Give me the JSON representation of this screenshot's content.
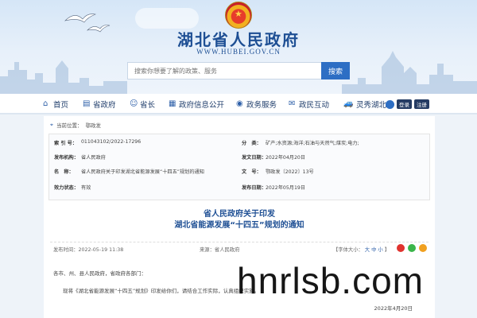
{
  "header": {
    "title": "湖北省人民政府",
    "url": "WWW.HUBEI.GOV.CN",
    "search_placeholder": "搜索你想要了解的政策、服务",
    "search_button": "搜索"
  },
  "nav": {
    "items": [
      {
        "label": "首页",
        "icon": "home-icon"
      },
      {
        "label": "省政府",
        "icon": "building-icon"
      },
      {
        "label": "省长",
        "icon": "person-icon"
      },
      {
        "label": "政府信息公开",
        "icon": "document-icon"
      },
      {
        "label": "政务服务",
        "icon": "service-icon"
      },
      {
        "label": "政民互动",
        "icon": "chat-icon"
      },
      {
        "label": "灵秀湖北",
        "icon": "car-icon"
      }
    ],
    "login_label": "登录",
    "register_label": "注册"
  },
  "breadcrumb": {
    "prefix": "当前位置：",
    "current": "鄂政发"
  },
  "meta": {
    "index_label": "索 引 号：",
    "index_value": "011043102/2022-17296",
    "category_label": "分　类：",
    "category_value": "矿产;水资源;海洋;石油与天然气;煤炭;电力;",
    "issuer_label": "发布机构：",
    "issuer_value": "省人民政府",
    "date_label": "发文日期：",
    "date_value": "2022年04月20日",
    "name_label": "名　称：",
    "name_value": "省人民政府关于印发湖北省能源发展“十四五”规划的通知",
    "docno_label": "文　号：",
    "docno_value": "鄂政发〔2022〕13号",
    "status_label": "效力状态：",
    "status_value": "有效",
    "pubdate_label": "发布日期：",
    "pubdate_value": "2022年05月19日"
  },
  "document": {
    "title_line1": "省人民政府关于印发",
    "title_line2": "湖北省能源发展“十四五”规划的通知",
    "publish_time": "发布时间：2022-05-19 11:38",
    "source": "来源：省人民政府",
    "font_label": "【字体大小：",
    "font_large": "大",
    "font_medium": "中",
    "font_small": "小",
    "font_close": "】",
    "salutation": "各市、州、县人民政府，省政府各部门：",
    "body": "现将《湖北省能源发展“十四五”规划》印发给你们，请结合工作实际，认真组织实施。",
    "sign_date": "2022年4月20日"
  },
  "watermark": "hnrlsb.com",
  "colors": {
    "brand_blue": "#1e4f94",
    "button_blue": "#2d6ec4",
    "weibo_red": "#e0332f",
    "wechat_green": "#3ab54a"
  }
}
